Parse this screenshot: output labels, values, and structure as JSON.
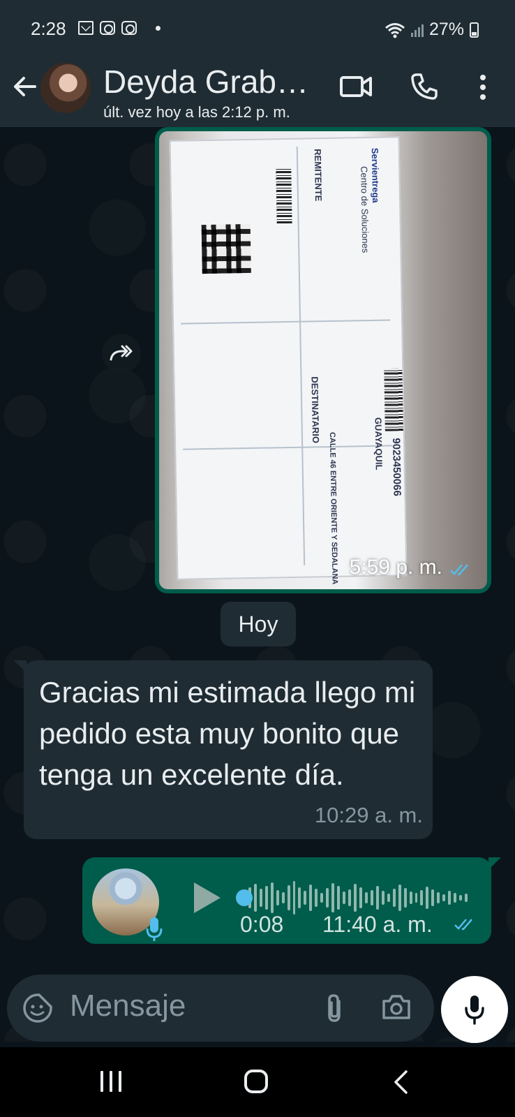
{
  "status_bar": {
    "time": "2:28",
    "battery": "27%",
    "icons": [
      "mail-icon",
      "instagram-icon",
      "instagram-icon",
      "dot-icon",
      "wifi-icon",
      "signal-icon",
      "battery-icon"
    ]
  },
  "header": {
    "contact_name": "Deyda Grab…",
    "last_seen": "últ. vez hoy a las 2:12 p. m.",
    "icons": [
      "back-arrow-icon",
      "video-call-icon",
      "phone-call-icon",
      "more-options-icon"
    ]
  },
  "messages": {
    "image_message": {
      "time": "5:59 p. m.",
      "ticket": {
        "remitente": "REMITENTE",
        "destinatario": "DESTINATARIO",
        "city": "GUAYAQUIL",
        "address": "CALLE 46 ENTRE ORIENTE Y SEDALANA",
        "tracking": "9023450066",
        "company": "Servientrega",
        "centro": "Centro de Soluciones"
      }
    },
    "date_separator": "Hoy",
    "incoming_text": {
      "text": "Gracias mi estimada llego mi pedido  esta muy bonito que tenga un excelente día.",
      "time": "10:29 a. m."
    },
    "voice_message": {
      "duration": "0:08",
      "time": "11:40 a. m."
    }
  },
  "input": {
    "placeholder": "Mensaje"
  },
  "colors": {
    "app_background": "#0b141a",
    "bar_background": "#1f2c34",
    "outgoing_bubble": "#005c4b",
    "incoming_bubble": "#1f2c34",
    "read_ticks": "#53bdeb",
    "secondary_text": "#8696a0"
  }
}
